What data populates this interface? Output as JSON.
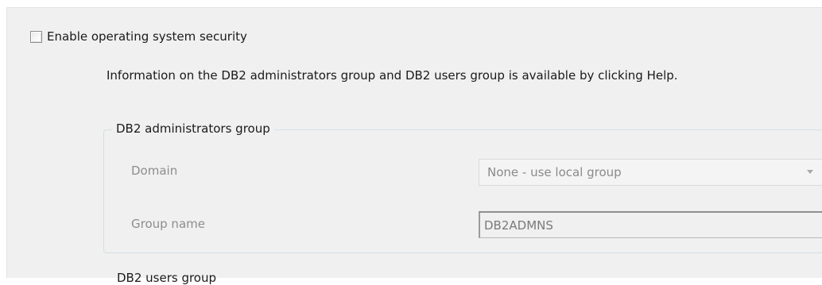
{
  "security": {
    "checkbox_label": "Enable operating system security",
    "checked": false
  },
  "info_text": "Information on the DB2 administrators group and DB2 users group is available by clicking Help.",
  "admin_group": {
    "title": "DB2 administrators group",
    "domain_label": "Domain",
    "domain_value": "None - use local group",
    "group_name_label": "Group name",
    "group_name_value": "DB2ADMNS"
  },
  "users_group": {
    "title": "DB2 users group"
  }
}
